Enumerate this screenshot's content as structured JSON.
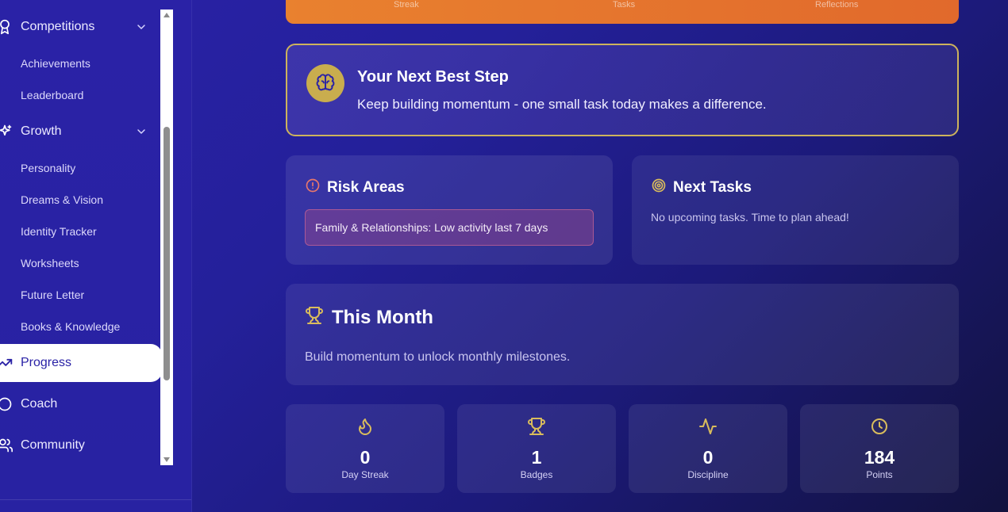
{
  "colors": {
    "accent_gold": "#c9ad4e",
    "accent_orange": "#e9812f",
    "sidebar_bg": "#2a22a6",
    "risk_red": "#e8776b",
    "active_text": "#2a22a6"
  },
  "sidebar": {
    "sections": [
      {
        "label": "Competitions",
        "icon": "award-icon",
        "expanded": true,
        "items": [
          "Achievements",
          "Leaderboard"
        ]
      },
      {
        "label": "Growth",
        "icon": "sparkles-icon",
        "expanded": true,
        "items": [
          "Personality",
          "Dreams & Vision",
          "Identity Tracker",
          "Worksheets",
          "Future Letter",
          "Books & Knowledge"
        ]
      }
    ],
    "progress": {
      "label": "Progress",
      "icon": "trending-up-icon",
      "active": true
    },
    "coach": {
      "label": "Coach",
      "icon": "message-circle-icon"
    },
    "community": {
      "label": "Community",
      "icon": "users-icon"
    }
  },
  "top_stats_captions": [
    "Streak",
    "Tasks",
    "Reflections"
  ],
  "next_step": {
    "title": "Your Next Best Step",
    "text": "Keep building momentum - one small task today makes a difference.",
    "icon": "brain-icon"
  },
  "risk_areas": {
    "title": "Risk Areas",
    "icon": "alert-circle-icon",
    "items": [
      "Family & Relationships: Low activity last 7 days"
    ]
  },
  "next_tasks": {
    "title": "Next Tasks",
    "icon": "target-icon",
    "empty_text": "No upcoming tasks. Time to plan ahead!"
  },
  "this_month": {
    "title": "This Month",
    "icon": "trophy-icon",
    "text": "Build momentum to unlock monthly milestones."
  },
  "stats": [
    {
      "value": "0",
      "label": "Day Streak",
      "icon": "flame-icon"
    },
    {
      "value": "1",
      "label": "Badges",
      "icon": "trophy-icon"
    },
    {
      "value": "0",
      "label": "Discipline",
      "icon": "activity-icon"
    },
    {
      "value": "184",
      "label": "Points",
      "icon": "clock-icon"
    }
  ]
}
